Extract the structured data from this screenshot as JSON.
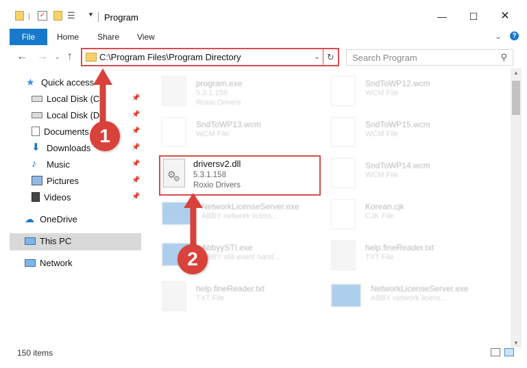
{
  "window": {
    "title": "Program"
  },
  "ribbon": {
    "tabs": [
      "File",
      "Home",
      "Share",
      "View"
    ]
  },
  "address": {
    "path": "C:\\Program Files\\Program Directory",
    "search_placeholder": "Search Program"
  },
  "sidebar": {
    "quick_access": "Quick access",
    "items": [
      {
        "label": "Local Disk (C:)",
        "icon": "drive-icon",
        "pinned": true
      },
      {
        "label": "Local Disk (D:)",
        "icon": "drive-icon",
        "pinned": true
      },
      {
        "label": "Documents",
        "icon": "documents-icon",
        "pinned": true
      },
      {
        "label": "Downloads",
        "icon": "downloads-icon",
        "pinned": true
      },
      {
        "label": "Music",
        "icon": "music-icon",
        "pinned": true
      },
      {
        "label": "Pictures",
        "icon": "pictures-icon",
        "pinned": true
      },
      {
        "label": "Videos",
        "icon": "videos-icon",
        "pinned": true
      }
    ],
    "onedrive": "OneDrive",
    "this_pc": "This PC",
    "network": "Network"
  },
  "files": [
    {
      "name": "program.exe",
      "line1": "5.3.1.158",
      "line2": "Roxio Drivers"
    },
    {
      "name": "SndToWP12.wcm",
      "line1": "WCM File",
      "line2": ""
    },
    {
      "name": "SndToWP13.wcm",
      "line1": "WCM File",
      "line2": ""
    },
    {
      "name": "SndToWP15.wcm",
      "line1": "WCM File",
      "line2": ""
    },
    {
      "name": "driversv2.dll",
      "line1": "5.3.1.158",
      "line2": "Roxio Drivers"
    },
    {
      "name": "SndToWP14.wcm",
      "line1": "WCM File",
      "line2": ""
    },
    {
      "name": "NetworkLicenseServer.exe",
      "line1": "ABBY network licens...",
      "line2": ""
    },
    {
      "name": "Korean.cjk",
      "line1": "CJK File",
      "line2": ""
    },
    {
      "name": "AbbyySTI.exe",
      "line1": "ABBY still event hand...",
      "line2": ""
    },
    {
      "name": "help.fineReader.txt",
      "line1": "TXT File",
      "line2": ""
    },
    {
      "name": "help.fineReader.txt",
      "line1": "TXT File",
      "line2": ""
    },
    {
      "name": "NetworkLicenseServer.exe",
      "line1": "ABBY network licens...",
      "line2": ""
    }
  ],
  "status": {
    "count": "150 items"
  },
  "annotations": {
    "step1": "1",
    "step2": "2",
    "color": "#d9413b"
  }
}
